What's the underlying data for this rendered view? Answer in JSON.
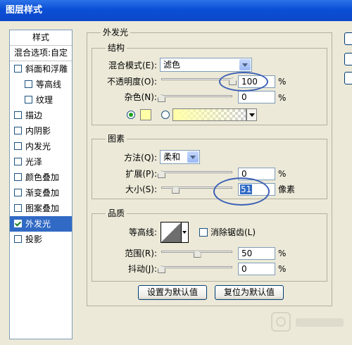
{
  "window": {
    "title": "图层样式"
  },
  "style_list": {
    "header": "样式",
    "blend_options": "混合选项:自定",
    "items": [
      {
        "label": "斜面和浮雕",
        "checked": false,
        "sub": false
      },
      {
        "label": "等高线",
        "checked": false,
        "sub": true
      },
      {
        "label": "纹理",
        "checked": false,
        "sub": true
      },
      {
        "label": "描边",
        "checked": false,
        "sub": false
      },
      {
        "label": "内阴影",
        "checked": false,
        "sub": false
      },
      {
        "label": "内发光",
        "checked": false,
        "sub": false
      },
      {
        "label": "光泽",
        "checked": false,
        "sub": false
      },
      {
        "label": "颜色叠加",
        "checked": false,
        "sub": false
      },
      {
        "label": "渐变叠加",
        "checked": false,
        "sub": false
      },
      {
        "label": "图案叠加",
        "checked": false,
        "sub": false
      },
      {
        "label": "外发光",
        "checked": true,
        "sub": false,
        "selected": true
      },
      {
        "label": "投影",
        "checked": false,
        "sub": false
      }
    ]
  },
  "outer_glow": {
    "title": "外发光",
    "structure": {
      "title": "结构",
      "blend_mode_label": "混合模式(E):",
      "blend_mode_value": "滤色",
      "opacity_label": "不透明度(O):",
      "opacity_value": "100",
      "opacity_unit": "%",
      "opacity_level": 1.0,
      "noise_label": "杂色(N):",
      "noise_value": "0",
      "noise_unit": "%",
      "noise_level": 0.0,
      "color_mode": "solid",
      "glow_color": "#ffffa8"
    },
    "elements": {
      "title": "图素",
      "technique_label": "方法(Q):",
      "technique_value": "柔和",
      "spread_label": "扩展(P):",
      "spread_value": "0",
      "spread_unit": "%",
      "spread_level": 0.0,
      "size_label": "大小(S):",
      "size_value": "51",
      "size_unit": "像素",
      "size_level": 0.2
    },
    "quality": {
      "title": "品质",
      "contour_label": "等高线:",
      "antialias_label": "消除锯齿(L)",
      "antialias_checked": false,
      "range_label": "范围(R):",
      "range_value": "50",
      "range_unit": "%",
      "range_level": 0.5,
      "jitter_label": "抖动(J):",
      "jitter_value": "0",
      "jitter_unit": "%",
      "jitter_level": 0.0
    },
    "buttons": {
      "make_default": "设置为默认值",
      "reset_default": "复位为默认值"
    }
  },
  "colors": {
    "title_bar": "#0a4fd6",
    "selection": "#316ac5",
    "highlight_ellipse": "#3b5fb5"
  }
}
